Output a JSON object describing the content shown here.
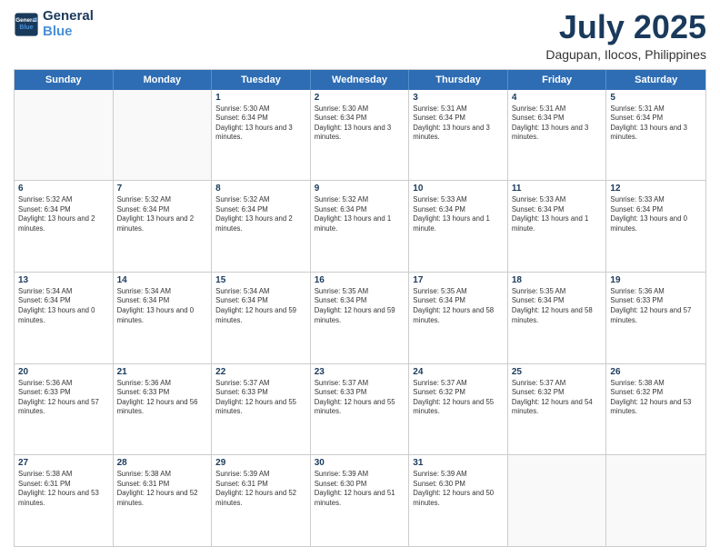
{
  "logo": {
    "line1": "General",
    "line2": "Blue"
  },
  "title": "July 2025",
  "subtitle": "Dagupan, Ilocos, Philippines",
  "header_days": [
    "Sunday",
    "Monday",
    "Tuesday",
    "Wednesday",
    "Thursday",
    "Friday",
    "Saturday"
  ],
  "weeks": [
    {
      "cells": [
        {
          "day": "",
          "empty": true
        },
        {
          "day": "",
          "empty": true
        },
        {
          "day": "1",
          "sunrise": "Sunrise: 5:30 AM",
          "sunset": "Sunset: 6:34 PM",
          "daylight": "Daylight: 13 hours and 3 minutes."
        },
        {
          "day": "2",
          "sunrise": "Sunrise: 5:30 AM",
          "sunset": "Sunset: 6:34 PM",
          "daylight": "Daylight: 13 hours and 3 minutes."
        },
        {
          "day": "3",
          "sunrise": "Sunrise: 5:31 AM",
          "sunset": "Sunset: 6:34 PM",
          "daylight": "Daylight: 13 hours and 3 minutes."
        },
        {
          "day": "4",
          "sunrise": "Sunrise: 5:31 AM",
          "sunset": "Sunset: 6:34 PM",
          "daylight": "Daylight: 13 hours and 3 minutes."
        },
        {
          "day": "5",
          "sunrise": "Sunrise: 5:31 AM",
          "sunset": "Sunset: 6:34 PM",
          "daylight": "Daylight: 13 hours and 3 minutes."
        }
      ]
    },
    {
      "cells": [
        {
          "day": "6",
          "sunrise": "Sunrise: 5:32 AM",
          "sunset": "Sunset: 6:34 PM",
          "daylight": "Daylight: 13 hours and 2 minutes."
        },
        {
          "day": "7",
          "sunrise": "Sunrise: 5:32 AM",
          "sunset": "Sunset: 6:34 PM",
          "daylight": "Daylight: 13 hours and 2 minutes."
        },
        {
          "day": "8",
          "sunrise": "Sunrise: 5:32 AM",
          "sunset": "Sunset: 6:34 PM",
          "daylight": "Daylight: 13 hours and 2 minutes."
        },
        {
          "day": "9",
          "sunrise": "Sunrise: 5:32 AM",
          "sunset": "Sunset: 6:34 PM",
          "daylight": "Daylight: 13 hours and 1 minute."
        },
        {
          "day": "10",
          "sunrise": "Sunrise: 5:33 AM",
          "sunset": "Sunset: 6:34 PM",
          "daylight": "Daylight: 13 hours and 1 minute."
        },
        {
          "day": "11",
          "sunrise": "Sunrise: 5:33 AM",
          "sunset": "Sunset: 6:34 PM",
          "daylight": "Daylight: 13 hours and 1 minute."
        },
        {
          "day": "12",
          "sunrise": "Sunrise: 5:33 AM",
          "sunset": "Sunset: 6:34 PM",
          "daylight": "Daylight: 13 hours and 0 minutes."
        }
      ]
    },
    {
      "cells": [
        {
          "day": "13",
          "sunrise": "Sunrise: 5:34 AM",
          "sunset": "Sunset: 6:34 PM",
          "daylight": "Daylight: 13 hours and 0 minutes."
        },
        {
          "day": "14",
          "sunrise": "Sunrise: 5:34 AM",
          "sunset": "Sunset: 6:34 PM",
          "daylight": "Daylight: 13 hours and 0 minutes."
        },
        {
          "day": "15",
          "sunrise": "Sunrise: 5:34 AM",
          "sunset": "Sunset: 6:34 PM",
          "daylight": "Daylight: 12 hours and 59 minutes."
        },
        {
          "day": "16",
          "sunrise": "Sunrise: 5:35 AM",
          "sunset": "Sunset: 6:34 PM",
          "daylight": "Daylight: 12 hours and 59 minutes."
        },
        {
          "day": "17",
          "sunrise": "Sunrise: 5:35 AM",
          "sunset": "Sunset: 6:34 PM",
          "daylight": "Daylight: 12 hours and 58 minutes."
        },
        {
          "day": "18",
          "sunrise": "Sunrise: 5:35 AM",
          "sunset": "Sunset: 6:34 PM",
          "daylight": "Daylight: 12 hours and 58 minutes."
        },
        {
          "day": "19",
          "sunrise": "Sunrise: 5:36 AM",
          "sunset": "Sunset: 6:33 PM",
          "daylight": "Daylight: 12 hours and 57 minutes."
        }
      ]
    },
    {
      "cells": [
        {
          "day": "20",
          "sunrise": "Sunrise: 5:36 AM",
          "sunset": "Sunset: 6:33 PM",
          "daylight": "Daylight: 12 hours and 57 minutes."
        },
        {
          "day": "21",
          "sunrise": "Sunrise: 5:36 AM",
          "sunset": "Sunset: 6:33 PM",
          "daylight": "Daylight: 12 hours and 56 minutes."
        },
        {
          "day": "22",
          "sunrise": "Sunrise: 5:37 AM",
          "sunset": "Sunset: 6:33 PM",
          "daylight": "Daylight: 12 hours and 55 minutes."
        },
        {
          "day": "23",
          "sunrise": "Sunrise: 5:37 AM",
          "sunset": "Sunset: 6:33 PM",
          "daylight": "Daylight: 12 hours and 55 minutes."
        },
        {
          "day": "24",
          "sunrise": "Sunrise: 5:37 AM",
          "sunset": "Sunset: 6:32 PM",
          "daylight": "Daylight: 12 hours and 55 minutes."
        },
        {
          "day": "25",
          "sunrise": "Sunrise: 5:37 AM",
          "sunset": "Sunset: 6:32 PM",
          "daylight": "Daylight: 12 hours and 54 minutes."
        },
        {
          "day": "26",
          "sunrise": "Sunrise: 5:38 AM",
          "sunset": "Sunset: 6:32 PM",
          "daylight": "Daylight: 12 hours and 53 minutes."
        }
      ]
    },
    {
      "cells": [
        {
          "day": "27",
          "sunrise": "Sunrise: 5:38 AM",
          "sunset": "Sunset: 6:31 PM",
          "daylight": "Daylight: 12 hours and 53 minutes."
        },
        {
          "day": "28",
          "sunrise": "Sunrise: 5:38 AM",
          "sunset": "Sunset: 6:31 PM",
          "daylight": "Daylight: 12 hours and 52 minutes."
        },
        {
          "day": "29",
          "sunrise": "Sunrise: 5:39 AM",
          "sunset": "Sunset: 6:31 PM",
          "daylight": "Daylight: 12 hours and 52 minutes."
        },
        {
          "day": "30",
          "sunrise": "Sunrise: 5:39 AM",
          "sunset": "Sunset: 6:30 PM",
          "daylight": "Daylight: 12 hours and 51 minutes."
        },
        {
          "day": "31",
          "sunrise": "Sunrise: 5:39 AM",
          "sunset": "Sunset: 6:30 PM",
          "daylight": "Daylight: 12 hours and 50 minutes."
        },
        {
          "day": "",
          "empty": true
        },
        {
          "day": "",
          "empty": true
        }
      ]
    }
  ]
}
